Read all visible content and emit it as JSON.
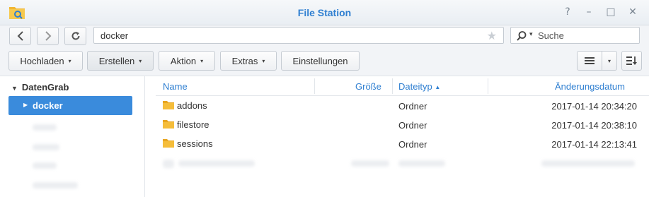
{
  "window": {
    "title": "File Station",
    "help_glyph": "?",
    "minimize_glyph": "–",
    "maximize_glyph": "□",
    "close_glyph": "✕"
  },
  "nav": {
    "path": "docker",
    "search_placeholder": "Suche",
    "star_glyph": "★"
  },
  "toolbar": {
    "upload": "Hochladen",
    "create": "Erstellen",
    "action": "Aktion",
    "extras": "Extras",
    "settings": "Einstellungen",
    "caret": "▾"
  },
  "sidebar": {
    "root": "DatenGrab",
    "selected": "docker",
    "root_tri": "▼",
    "sel_tri": "▶"
  },
  "table": {
    "columns": {
      "name": "Name",
      "size": "Größe",
      "type": "Dateityp",
      "sort_arrow": "▲",
      "modified": "Änderungsdatum"
    },
    "rows": [
      {
        "name": "addons",
        "type": "Ordner",
        "date": "2017-01-14 20:34:20"
      },
      {
        "name": "filestore",
        "type": "Ordner",
        "date": "2017-01-14 20:38:10"
      },
      {
        "name": "sessions",
        "type": "Ordner",
        "date": "2017-01-14 22:13:41"
      }
    ]
  },
  "colors": {
    "accent": "#2f7fd1",
    "selection": "#3a8bdc",
    "folder": "#f2b632"
  }
}
